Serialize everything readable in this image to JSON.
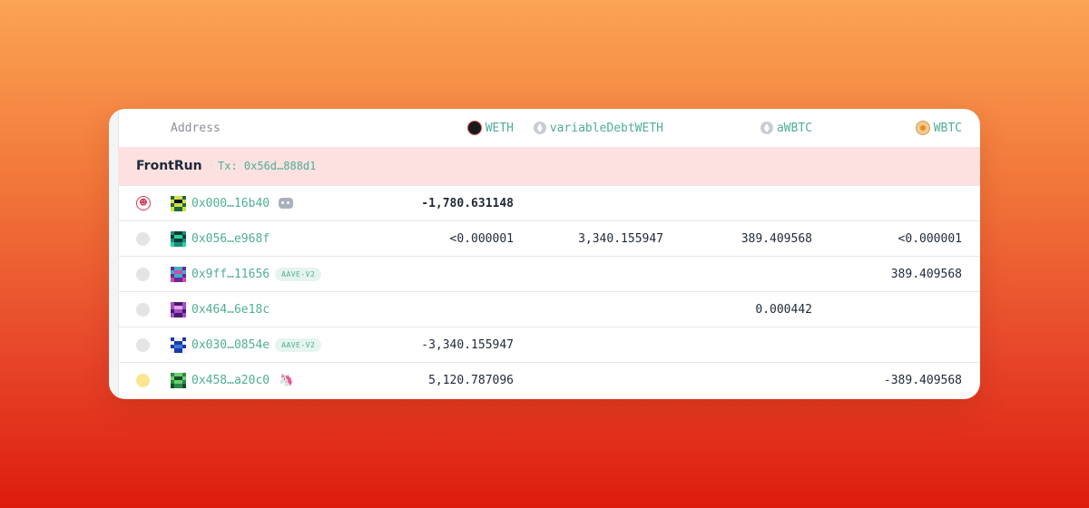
{
  "header": {
    "address_label": "Address",
    "columns": [
      {
        "label": "WETH",
        "icon": "weth-icon"
      },
      {
        "label": "variableDebtWETH",
        "icon": "eth-icon"
      },
      {
        "label": "aWBTC",
        "icon": "eth-icon"
      },
      {
        "label": "WBTC",
        "icon": "wbtc-icon"
      }
    ]
  },
  "group": {
    "title": "FrontRun",
    "tx": "Tx: 0x56d…888d1"
  },
  "rows": [
    {
      "status": "attacker-face",
      "address": "0x000…16b40",
      "tag": "",
      "extra_icon": "robot-icon",
      "values": [
        "-1,780.631148",
        "",
        "",
        ""
      ]
    },
    {
      "status": "grey",
      "address": "0x056…e968f",
      "tag": "",
      "extra_icon": "",
      "values": [
        "<0.000001",
        "3,340.155947",
        "389.409568",
        "<0.000001"
      ]
    },
    {
      "status": "grey",
      "address": "0x9ff…11656",
      "tag": "AAVE-V2",
      "extra_icon": "",
      "values": [
        "",
        "",
        "",
        "389.409568"
      ]
    },
    {
      "status": "grey",
      "address": "0x464…6e18c",
      "tag": "",
      "extra_icon": "",
      "values": [
        "",
        "",
        "0.000442",
        ""
      ]
    },
    {
      "status": "grey",
      "address": "0x030…0854e",
      "tag": "AAVE-V2",
      "extra_icon": "",
      "values": [
        "-3,340.155947",
        "",
        "",
        ""
      ]
    },
    {
      "status": "yellow",
      "address": "0x458…a20c0",
      "tag": "",
      "extra_icon": "uniswap-icon",
      "values": [
        "5,120.787096",
        "",
        "",
        "-389.409568"
      ]
    }
  ],
  "colors": {
    "accent": "#4fae93",
    "frontrun_bg": "#fde1e1",
    "attacker": "#d83a5a"
  }
}
